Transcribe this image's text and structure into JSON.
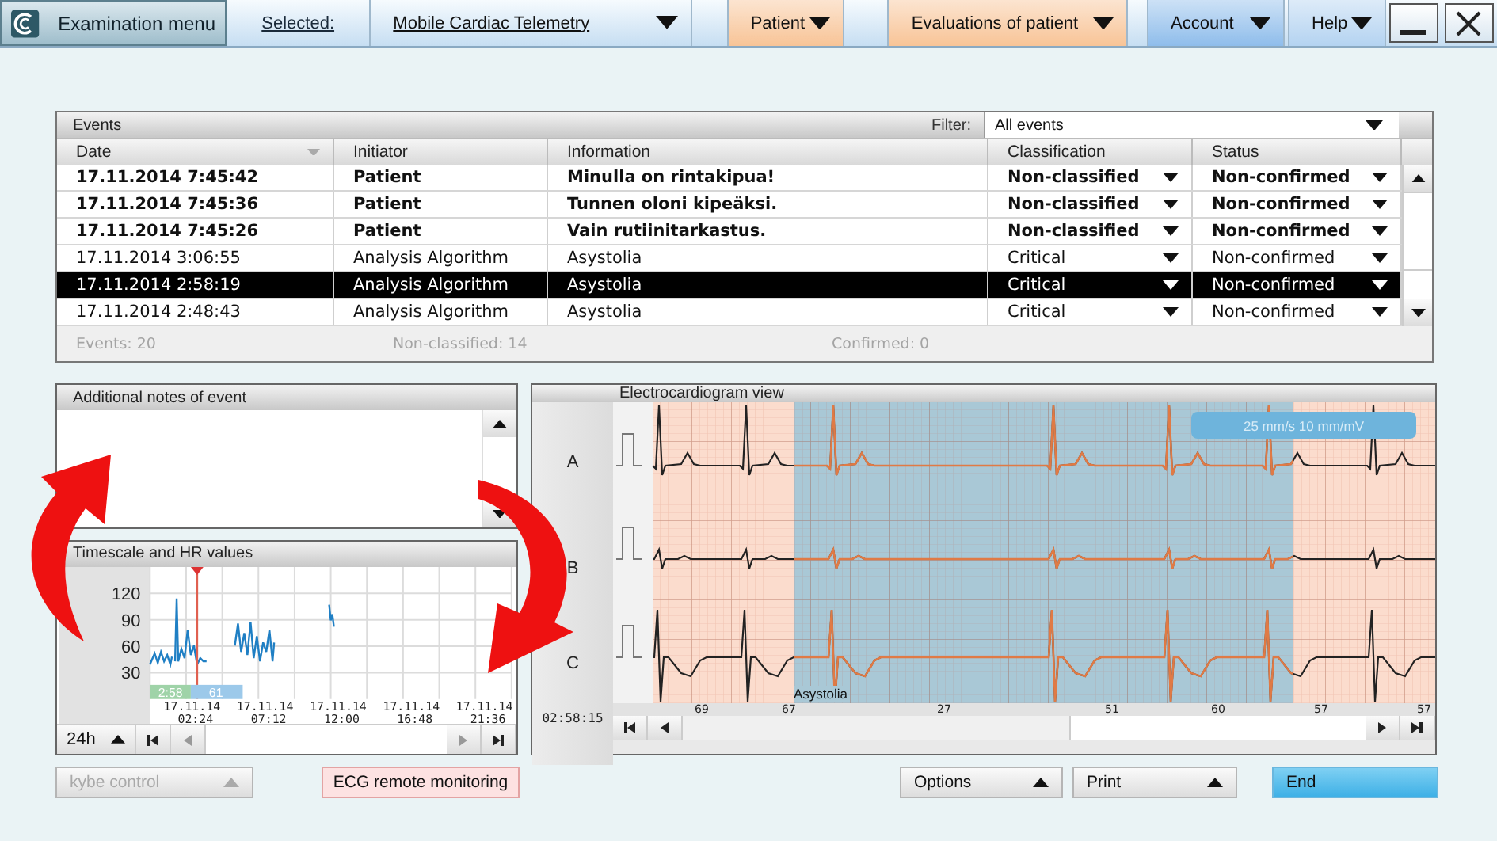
{
  "topbar": {
    "menu_button": "Examination menu",
    "selected_label": "Selected:",
    "selected_value": "Mobile Cardiac Telemetry",
    "menus": [
      {
        "label": "Patient",
        "color": "#f8c497"
      },
      {
        "label": "Evaluations of patient",
        "color": "#f8c497"
      },
      {
        "label": "Account",
        "color": "#8fbdeb"
      },
      {
        "label": "Help",
        "color": "#b4d3f1"
      }
    ]
  },
  "events": {
    "title": "Events",
    "filter_label": "Filter:",
    "filter_value": "All events",
    "columns": [
      "Date",
      "Initiator",
      "Information",
      "Classification",
      "Status"
    ],
    "rows": [
      {
        "date": "17.11.2014 7:45:42",
        "initiator": "Patient",
        "information": "Minulla on rintakipua!",
        "classification": "Non-classified",
        "status": "Non-confirmed",
        "unread": true,
        "selected": false
      },
      {
        "date": "17.11.2014 7:45:36",
        "initiator": "Patient",
        "information": "Tunnen oloni kipeäksi.",
        "classification": "Non-classified",
        "status": "Non-confirmed",
        "unread": true,
        "selected": false
      },
      {
        "date": "17.11.2014 7:45:26",
        "initiator": "Patient",
        "information": "Vain rutiinitarkastus.",
        "classification": "Non-classified",
        "status": "Non-confirmed",
        "unread": true,
        "selected": false
      },
      {
        "date": "17.11.2014 3:06:55",
        "initiator": "Analysis Algorithm",
        "information": "Asystolia",
        "classification": "Critical",
        "status": "Non-confirmed",
        "unread": false,
        "selected": false
      },
      {
        "date": "17.11.2014 2:58:19",
        "initiator": "Analysis Algorithm",
        "information": "Asystolia",
        "classification": "Critical",
        "status": "Non-confirmed",
        "unread": false,
        "selected": true
      },
      {
        "date": "17.11.2014 2:48:43",
        "initiator": "Analysis Algorithm",
        "information": "Asystolia",
        "classification": "Critical",
        "status": "Non-confirmed",
        "unread": false,
        "selected": false
      }
    ],
    "footer": [
      "Events: 20",
      "Non-classified: 14",
      "Confirmed: 0"
    ]
  },
  "notes": {
    "title": "Additional notes of event"
  },
  "timescale": {
    "title": "Timescale and HR values",
    "range": "24h",
    "cursor_time": "2:58",
    "cursor_hr": "61",
    "y_labels": [
      "120",
      "90",
      "60",
      "30"
    ],
    "time_labels": [
      "17.11.14 02:24",
      "17.11.14 07:12",
      "17.11.14 12:00",
      "17.11.14 16:48",
      "17.11.14 21:36"
    ]
  },
  "ecg": {
    "title": "Electrocardiogram view",
    "leads": [
      "A",
      "B",
      "C"
    ],
    "time": "02:58:15",
    "scale": "25 mm/s 10 mm/mV",
    "event_label": "Asystolia",
    "hr_values": [
      "69",
      "67",
      "27",
      "51",
      "60",
      "57",
      "57"
    ]
  },
  "buttons": [
    {
      "label": "kybe control",
      "kind": "menu",
      "disabled": true
    },
    {
      "label": "ECG remote monitoring",
      "kind": "alert",
      "disabled": false
    },
    {
      "label": "Options",
      "kind": "menu",
      "disabled": false
    },
    {
      "label": "Print",
      "kind": "menu",
      "disabled": false
    },
    {
      "label": "End",
      "kind": "primary",
      "disabled": false
    }
  ]
}
